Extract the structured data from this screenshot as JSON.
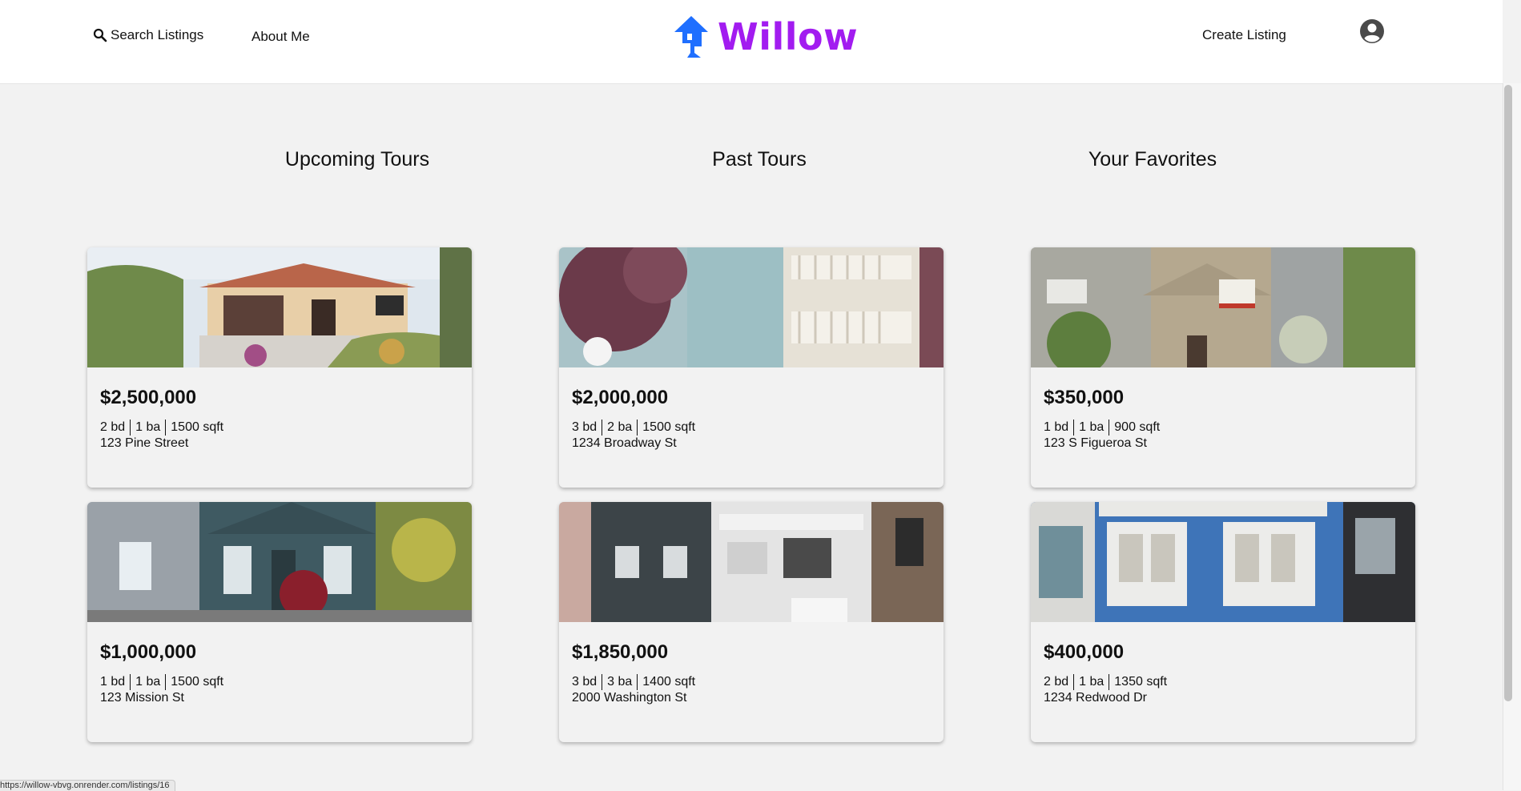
{
  "header": {
    "search_label": "Search Listings",
    "about_label": "About Me",
    "brand_name": "Willow",
    "create_label": "Create Listing"
  },
  "colors": {
    "brand_purple": "#a21cf0",
    "logo_blue": "#1f6fff",
    "page_bg": "#f2f2f2"
  },
  "columns": [
    {
      "title": "Upcoming Tours",
      "cards": [
        {
          "price": "$2,500,000",
          "beds": "2 bd",
          "baths": "1 ba",
          "sqft": "1500 sqft",
          "address": "123 Pine Street"
        },
        {
          "price": "$1,000,000",
          "beds": "1 bd",
          "baths": "1 ba",
          "sqft": "1500 sqft",
          "address": "123 Mission St"
        }
      ]
    },
    {
      "title": "Past Tours",
      "cards": [
        {
          "price": "$2,000,000",
          "beds": "3 bd",
          "baths": "2 ba",
          "sqft": "1500 sqft",
          "address": "1234 Broadway St"
        },
        {
          "price": "$1,850,000",
          "beds": "3 bd",
          "baths": "3 ba",
          "sqft": "1400 sqft",
          "address": "2000 Washington St"
        }
      ]
    },
    {
      "title": "Your Favorites",
      "cards": [
        {
          "price": "$350,000",
          "beds": "1 bd",
          "baths": "1 ba",
          "sqft": "900 sqft",
          "address": "123 S Figueroa St"
        },
        {
          "price": "$400,000",
          "beds": "2 bd",
          "baths": "1 ba",
          "sqft": "1350 sqft",
          "address": "1234 Redwood Dr"
        }
      ]
    }
  ],
  "status_bar": {
    "url": "https://willow-vbvg.onrender.com/listings/16"
  }
}
